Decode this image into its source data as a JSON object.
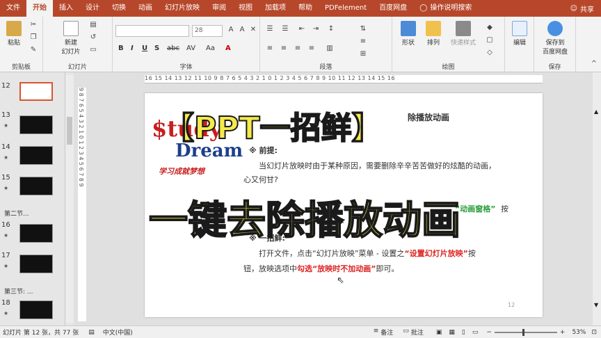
{
  "menu": {
    "tabs": [
      "文件",
      "开始",
      "插入",
      "设计",
      "切换",
      "动画",
      "幻灯片放映",
      "审阅",
      "视图",
      "加载项",
      "帮助",
      "PDFelement",
      "百度网盘"
    ],
    "tell_me": "操作说明搜索",
    "share": "共享"
  },
  "ribbon": {
    "clipboard": {
      "paste": "粘贴",
      "label": "剪贴板"
    },
    "slides": {
      "new_slide_line1": "新建",
      "new_slide_line2": "幻灯片",
      "label": "幻灯片"
    },
    "font": {
      "font_size": "28",
      "label": "字体",
      "format_buttons": [
        "B",
        "I",
        "U",
        "S",
        "abc",
        "AV",
        "Aa",
        "A"
      ]
    },
    "paragraph": {
      "label": "段落"
    },
    "drawing": {
      "shape": "形状",
      "arrange": "排列",
      "quick_styles": "快速样式",
      "label": "绘图"
    },
    "editing": {
      "edit": "编辑"
    },
    "save": {
      "line1": "保存到",
      "line2": "百度网盘",
      "label": "保存"
    }
  },
  "slides_panel": {
    "items": [
      {
        "num": "12",
        "star": ""
      },
      {
        "num": "13",
        "star": "★"
      },
      {
        "num": "14",
        "star": "★"
      },
      {
        "num": "15",
        "star": "★"
      },
      {
        "num": "16",
        "star": "★"
      },
      {
        "num": "17",
        "star": "★"
      },
      {
        "num": "18",
        "star": "★"
      }
    ],
    "sections": [
      "第二节...",
      "第三节: ..."
    ]
  },
  "ruler": {
    "h": "16 15 14 13 12 11 10 9 8 7 6 5 4 3 2 1 0 1 2 3 4 5 6 7 8 9 10 11 12 13 14 15 16",
    "v": "9 8 7 6 5 4 3 2 1 0 1 2 3 4 5 6 7 8 9"
  },
  "slide": {
    "logo_s": "$tudy",
    "logo_dream": "Dream",
    "logo_sub": "学习成就梦想",
    "title_tail": "除播放动画",
    "title_head": "【",
    "premise_label": "※ 前提:",
    "premise_text1": "当幻灯片放映时由于某种原因，需要删除辛辛苦苦做好的炫酷的动画，",
    "premise_text2": "心又何甘?",
    "method_text_tail": "按",
    "method_highlight": "“动画窗格”",
    "trick_label": "※ 一招鲜:",
    "trick_text1": "打开文件，点击“幻灯片放映”菜单 - 设置之",
    "trick_highlight1": "“设置幻灯片放映”",
    "trick_text1_end": "按",
    "trick_text2": "钮，放映选项中",
    "trick_highlight2": "勾选“放映时不加动画”",
    "trick_text2_end": "即可。",
    "page_num": "12"
  },
  "overlay": {
    "line1": "【PPT一招鲜】",
    "line2": "一键去除播放动画"
  },
  "status": {
    "slide_info": "幻灯片 第 12 张，共 77 张",
    "language": "中文(中国)",
    "notes": "备注",
    "comments": "批注",
    "zoom": "53%"
  }
}
